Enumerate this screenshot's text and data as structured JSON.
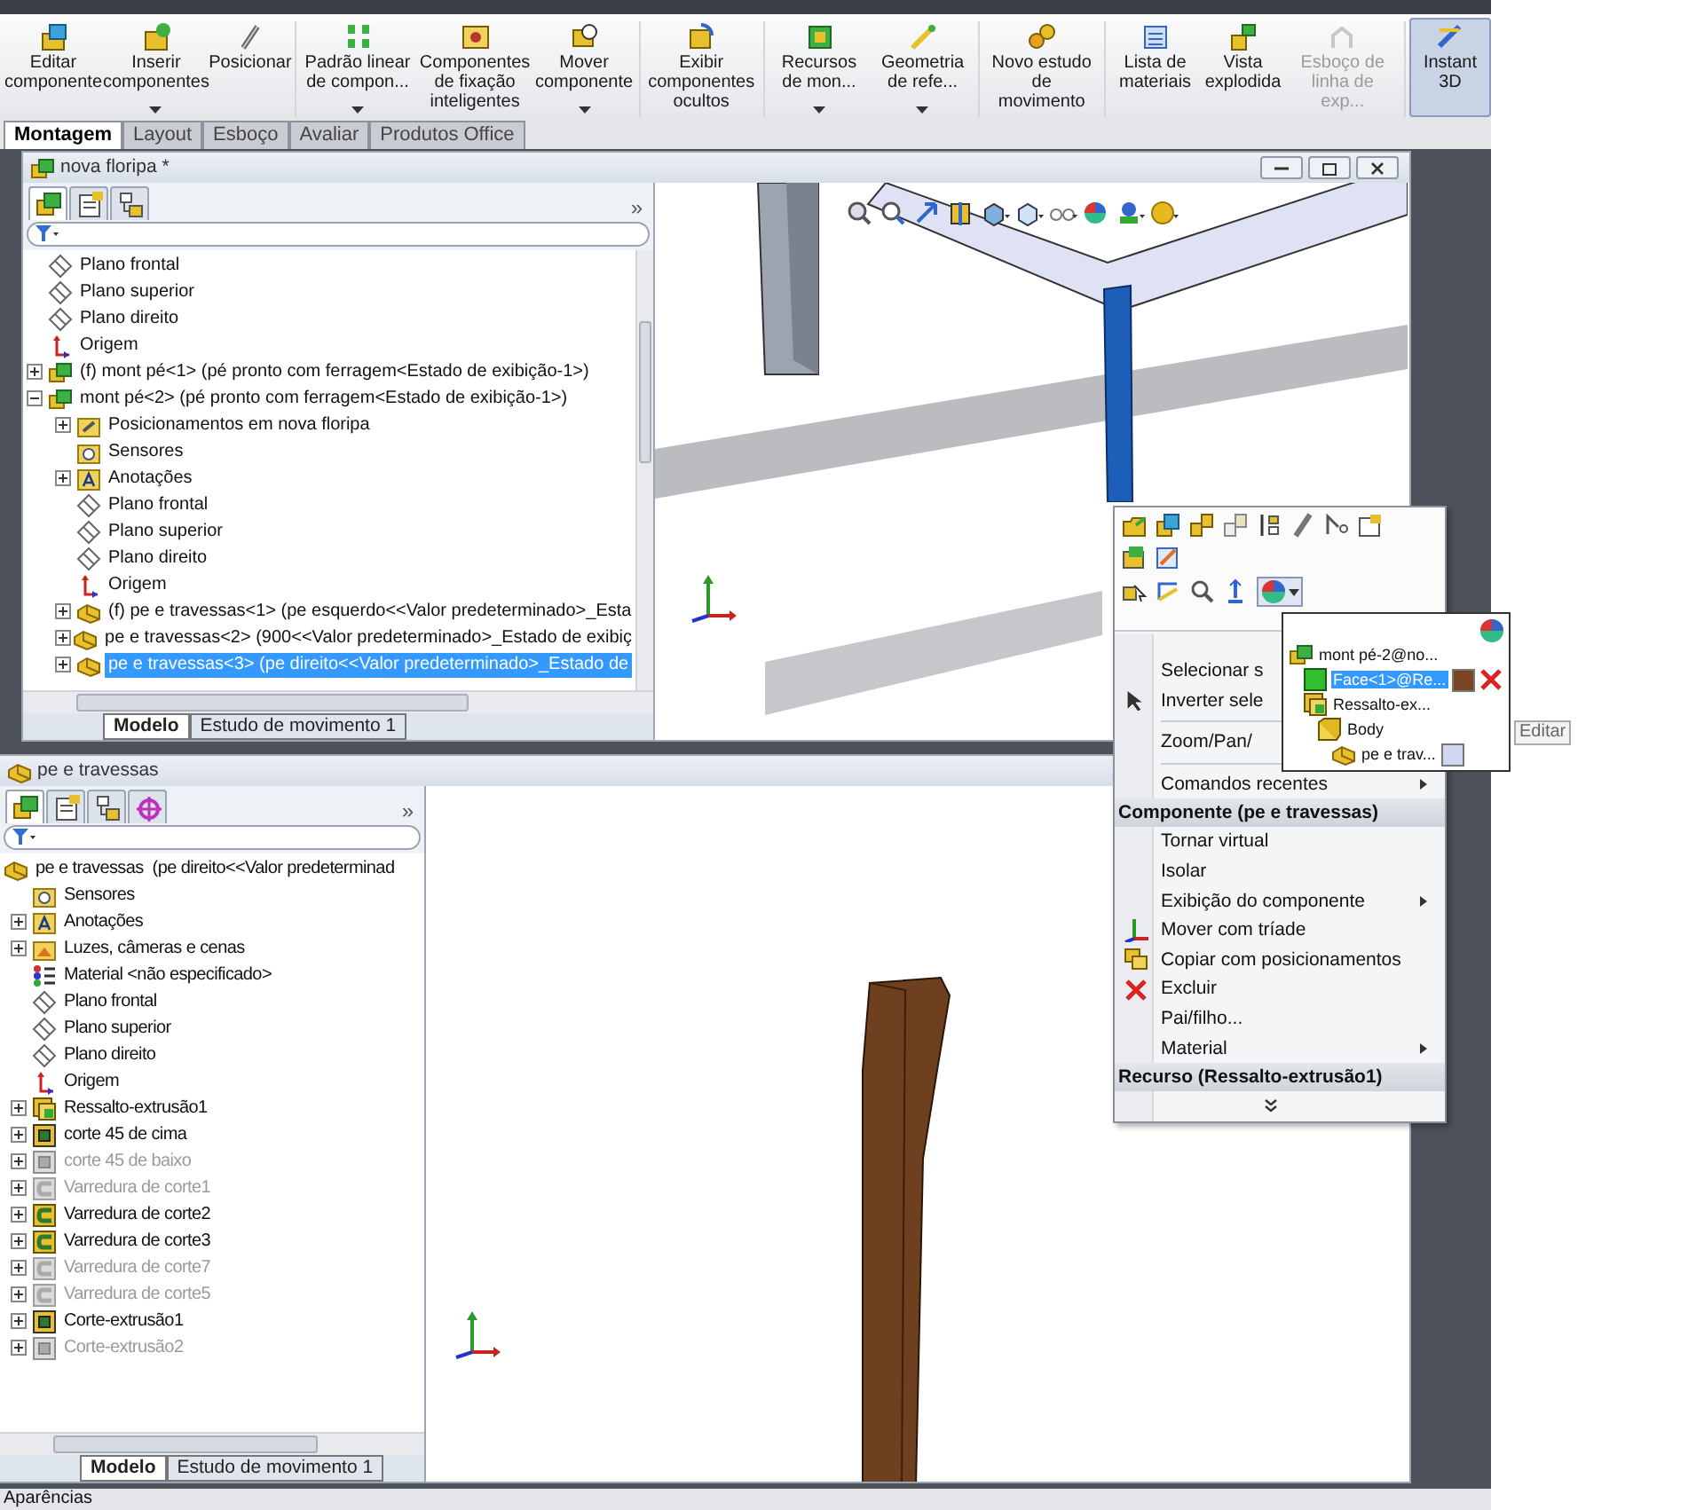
{
  "ribbon": {
    "buttons": [
      {
        "label": "Editar componente",
        "dropdown": false,
        "disabled": false,
        "selected": false
      },
      {
        "label": "Inserir componentes",
        "dropdown": true,
        "disabled": false,
        "selected": false
      },
      {
        "label": "Posicionar",
        "dropdown": false,
        "disabled": false,
        "selected": false
      },
      {
        "label": "Padrão linear de compon...",
        "dropdown": true,
        "disabled": false,
        "selected": false
      },
      {
        "label": "Componentes de fixação inteligentes",
        "dropdown": false,
        "disabled": false,
        "selected": false
      },
      {
        "label": "Mover componente",
        "dropdown": true,
        "disabled": false,
        "selected": false
      },
      {
        "label": "Exibir componentes ocultos",
        "dropdown": false,
        "disabled": false,
        "selected": false
      },
      {
        "label": "Recursos de mon...",
        "dropdown": true,
        "disabled": false,
        "selected": false
      },
      {
        "label": "Geometria de refe...",
        "dropdown": true,
        "disabled": false,
        "selected": false
      },
      {
        "label": "Novo estudo de movimento",
        "dropdown": false,
        "disabled": false,
        "selected": false
      },
      {
        "label": "Lista de materiais",
        "dropdown": false,
        "disabled": false,
        "selected": false
      },
      {
        "label": "Vista explodida",
        "dropdown": false,
        "disabled": false,
        "selected": false
      },
      {
        "label": "Esboço de linha de exp...",
        "dropdown": false,
        "disabled": true,
        "selected": false
      },
      {
        "label": "Instant 3D",
        "dropdown": false,
        "disabled": false,
        "selected": true
      }
    ]
  },
  "command_tabs": [
    {
      "label": "Montagem",
      "selected": true
    },
    {
      "label": "Layout",
      "selected": false
    },
    {
      "label": "Esboço",
      "selected": false
    },
    {
      "label": "Avaliar",
      "selected": false
    },
    {
      "label": "Produtos Office",
      "selected": false
    }
  ],
  "windows": [
    {
      "kind": "assembly",
      "title": "nova floripa *",
      "panel_tabs": [
        {
          "kind": "feature-tree",
          "selected": true
        },
        {
          "kind": "property",
          "selected": false
        },
        {
          "kind": "configuration",
          "selected": false
        }
      ],
      "expand_glyph": "»",
      "tree": [
        {
          "label": "Plano frontal",
          "kind": "plane",
          "selected": false
        },
        {
          "label": "Plano superior",
          "kind": "plane",
          "selected": false
        },
        {
          "label": "Plano direito",
          "kind": "plane",
          "selected": false
        },
        {
          "label": "Origem",
          "kind": "origin",
          "selected": false
        },
        {
          "label": "(f) mont pé<1> (pé pronto com ferragem<Estado de exibição-1>)",
          "kind": "assembly",
          "expanded": false,
          "selected": false
        },
        {
          "label": "mont pé<2> (pé pronto com ferragem<Estado de exibição-1>)",
          "kind": "assembly",
          "expanded": true,
          "selected": false,
          "children": [
            {
              "label": "Posicionamentos em nova floripa",
              "kind": "mates",
              "expanded": false,
              "selected": false
            },
            {
              "label": "Sensores",
              "kind": "sensor",
              "selected": false
            },
            {
              "label": "Anotações",
              "kind": "annotation",
              "expanded": false,
              "selected": false
            },
            {
              "label": "Plano frontal",
              "kind": "plane",
              "selected": false
            },
            {
              "label": "Plano superior",
              "kind": "plane",
              "selected": false
            },
            {
              "label": "Plano direito",
              "kind": "plane",
              "selected": false
            },
            {
              "label": "Origem",
              "kind": "origin",
              "selected": false
            },
            {
              "label": "(f) pe e travessas<1> (pe esquerdo<<Valor predeterminado>_Esta",
              "kind": "part",
              "expanded": false,
              "selected": false
            },
            {
              "label": "pe e travessas<2> (900<<Valor predeterminado>_Estado de exibiç",
              "kind": "part",
              "expanded": false,
              "selected": false
            },
            {
              "label": "pe e travessas<3> (pe direito<<Valor predeterminado>_Estado de",
              "kind": "part",
              "expanded": false,
              "selected": true
            }
          ]
        }
      ],
      "bottom_tabs": [
        {
          "label": "Modelo",
          "selected": true
        },
        {
          "label": "Estudo de movimento 1",
          "selected": false
        }
      ]
    },
    {
      "kind": "part",
      "title": "pe e travessas",
      "panel_tabs": [
        {
          "kind": "feature-tree",
          "selected": true
        },
        {
          "kind": "property",
          "selected": false
        },
        {
          "kind": "configuration",
          "selected": false
        },
        {
          "kind": "dimxpert",
          "selected": false
        }
      ],
      "expand_glyph": "»",
      "tree": [
        {
          "label": "pe e travessas  (pe direito<<Valor predeterminad",
          "kind": "part",
          "selected": false,
          "suppressed": false,
          "children": [
            {
              "label": "Sensores",
              "kind": "sensor",
              "selected": false,
              "suppressed": false
            },
            {
              "label": "Anotações",
              "kind": "annotation",
              "expanded": false,
              "selected": false,
              "suppressed": false
            },
            {
              "label": "Luzes, câmeras e cenas",
              "kind": "lights",
              "expanded": false,
              "selected": false,
              "suppressed": false
            },
            {
              "label": "Material <não especificado>",
              "kind": "material",
              "selected": false,
              "suppressed": false
            },
            {
              "label": "Plano frontal",
              "kind": "plane",
              "selected": false,
              "suppressed": false
            },
            {
              "label": "Plano superior",
              "kind": "plane",
              "selected": false,
              "suppressed": false
            },
            {
              "label": "Plano direito",
              "kind": "plane",
              "selected": false,
              "suppressed": false
            },
            {
              "label": "Origem",
              "kind": "origin",
              "selected": false,
              "suppressed": false
            },
            {
              "label": "Ressalto-extrusão1",
              "kind": "extrude",
              "expanded": false,
              "selected": false,
              "suppressed": false
            },
            {
              "label": "corte 45 de cima",
              "kind": "cut",
              "expanded": false,
              "selected": false,
              "suppressed": false
            },
            {
              "label": "corte 45 de baixo",
              "kind": "cut",
              "expanded": false,
              "selected": false,
              "suppressed": true
            },
            {
              "label": "Varredura de corte1",
              "kind": "sweep",
              "expanded": false,
              "selected": false,
              "suppressed": true
            },
            {
              "label": "Varredura de corte2",
              "kind": "sweep",
              "expanded": false,
              "selected": false,
              "suppressed": false
            },
            {
              "label": "Varredura de corte3",
              "kind": "sweep",
              "expanded": false,
              "selected": false,
              "suppressed": false
            },
            {
              "label": "Varredura de corte7",
              "kind": "sweep",
              "expanded": false,
              "selected": false,
              "suppressed": true
            },
            {
              "label": "Varredura de corte5",
              "kind": "sweep",
              "expanded": false,
              "selected": false,
              "suppressed": true
            },
            {
              "label": "Corte-extrusão1",
              "kind": "cut",
              "expanded": false,
              "selected": false,
              "suppressed": false
            },
            {
              "label": "Corte-extrusão2",
              "kind": "cut",
              "expanded": false,
              "selected": false,
              "suppressed": true
            }
          ]
        }
      ],
      "bottom_tabs": [
        {
          "label": "Modelo",
          "selected": true
        },
        {
          "label": "Estudo de movimento 1",
          "selected": false
        }
      ]
    }
  ],
  "context_menu": {
    "items": [
      {
        "kind": "plain",
        "label": "Selecionar s"
      },
      {
        "kind": "cursor",
        "label": "Inverter sele"
      },
      {
        "kind": "separator"
      },
      {
        "kind": "plain",
        "label": "Zoom/Pan/"
      },
      {
        "kind": "separator"
      },
      {
        "kind": "plain",
        "label": "Comandos recentes",
        "submenu": true
      },
      {
        "kind": "header",
        "label": "Componente (pe e travessas)"
      },
      {
        "kind": "plain",
        "label": "Tornar virtual",
        "submenu": false
      },
      {
        "kind": "plain",
        "label": "Isolar",
        "submenu": false
      },
      {
        "kind": "plain",
        "label": "Exibição do componente",
        "submenu": true
      },
      {
        "kind": "triad",
        "label": "Mover com tríade",
        "submenu": false
      },
      {
        "kind": "copy",
        "label": "Copiar com posicionamentos",
        "submenu": false
      },
      {
        "kind": "delete",
        "label": "Excluir",
        "submenu": false
      },
      {
        "kind": "plain",
        "label": "Pai/filho...",
        "submenu": false
      },
      {
        "kind": "plain",
        "label": "Material",
        "submenu": true
      },
      {
        "kind": "header",
        "label": "Recurso (Ressalto-extrusão1)"
      },
      {
        "kind": "more"
      }
    ]
  },
  "appearance_popup": {
    "items": [
      {
        "label": "mont pé-2@no...",
        "kind": "assembly",
        "selected": false,
        "children": [
          {
            "label": "Face<1>@Re...",
            "kind": "face",
            "selected": true,
            "color": "#7a4524"
          },
          {
            "label": "Ressalto-ex...",
            "kind": "extrude",
            "selected": false,
            "children": [
              {
                "label": "Body",
                "kind": "body",
                "selected": false,
                "children": [
                  {
                    "label": "pe e trav...",
                    "kind": "part",
                    "selected": false,
                    "color": "#cfd6ee"
                  }
                ]
              }
            ]
          }
        ]
      }
    ],
    "tooltip": "Editar"
  },
  "status_bar": "Aparências"
}
